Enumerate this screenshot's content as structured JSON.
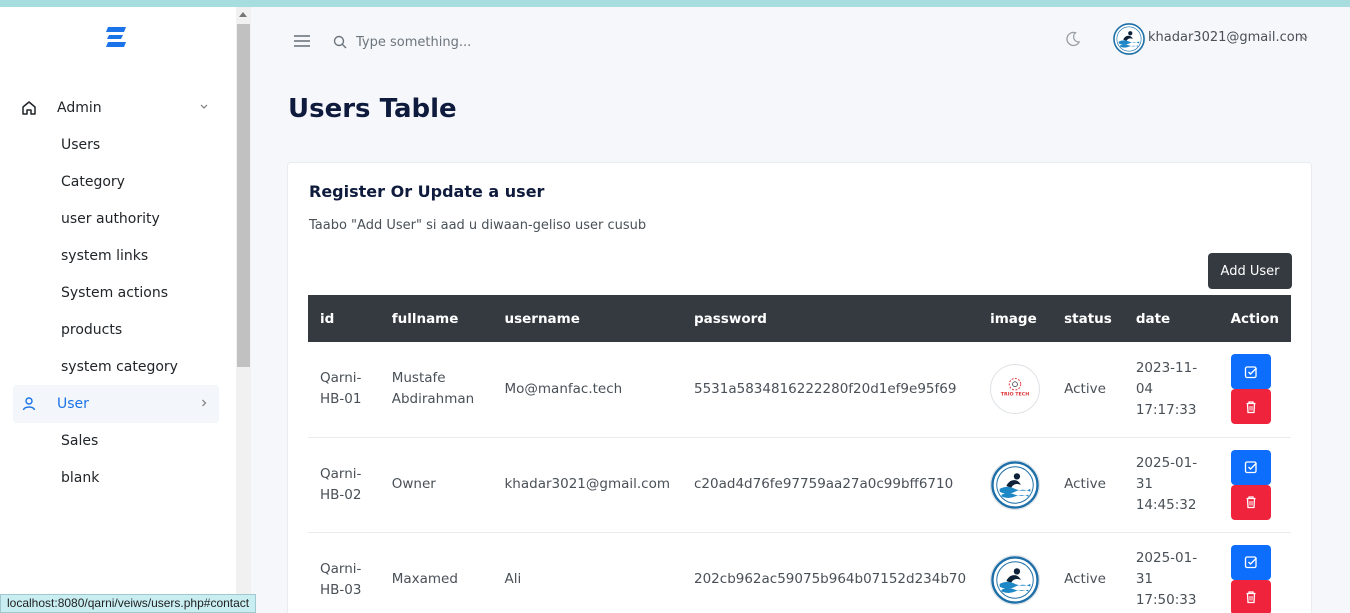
{
  "header": {
    "search_placeholder": "Type something...",
    "user_email": "khadar3021@gmail.com"
  },
  "sidebar": {
    "groups": [
      {
        "label": "Admin",
        "items": [
          "Users",
          "Category",
          "user authority",
          "system links",
          "System actions",
          "products",
          "system category"
        ]
      },
      {
        "label": "User",
        "items": [
          "Sales",
          "blank"
        ]
      }
    ]
  },
  "page": {
    "title": "Users Table"
  },
  "card": {
    "title": "Register Or Update a user",
    "subtitle": "Taabo \"Add User\" si aad u diwaan-geliso user cusub",
    "add_button": "Add User"
  },
  "table": {
    "columns": [
      "id",
      "fullname",
      "username",
      "password",
      "image",
      "status",
      "date",
      "Action"
    ],
    "rows": [
      {
        "id": "Qarni-HB-01",
        "fullname": "Mustafe Abdirahman",
        "username": "Mo@manfac.tech",
        "password": "5531a5834816222280f20d1ef9e95f69",
        "image": "logo-trio-tech",
        "logo_text": "TRIO TECH",
        "status": "Active",
        "date": "2023-11-04 17:17:33"
      },
      {
        "id": "Qarni-HB-02",
        "fullname": "Owner",
        "username": "khadar3021@gmail.com",
        "password": "c20ad4d76fe97759aa27a0c99bff6710",
        "image": "swimmer-logo",
        "status": "Active",
        "date": "2025-01-31 14:45:32"
      },
      {
        "id": "Qarni-HB-03",
        "fullname": "Maxamed",
        "username": "Ali",
        "password": "202cb962ac59075b964b07152d234b70",
        "image": "swimmer-logo",
        "status": "Active",
        "date": "2025-01-31 17:50:33"
      }
    ]
  },
  "status_bar": "localhost:8080/qarni/veiws/users.php#contact",
  "colors": {
    "primary": "#0d6efd",
    "danger": "#f0233c",
    "dark": "#343a40",
    "active_link": "#1a73e8"
  }
}
